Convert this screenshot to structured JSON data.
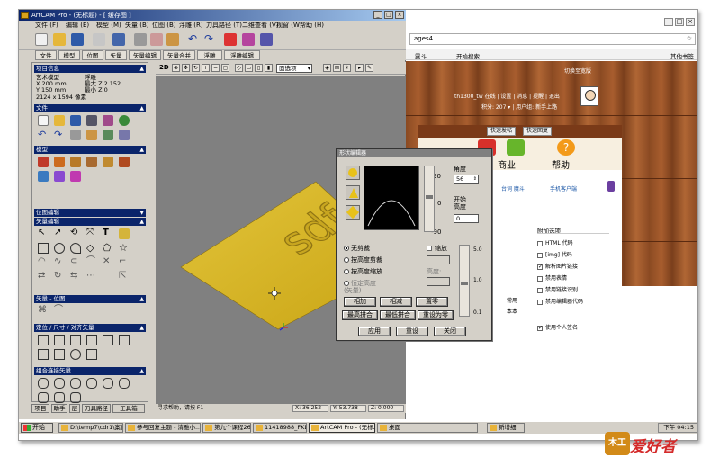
{
  "artcam": {
    "title": "ArtCAM Pro - (无标题) - [ 缓存图 ]",
    "menu": [
      "文件 (F)",
      "编辑 (E)",
      "模型 (M)",
      "矢量 (B)",
      "位图 (B)",
      "浮雕 (R)",
      "刀具路径 (T)",
      "二维查看 (V)",
      "视窗 (W)",
      "帮助 (H)"
    ],
    "tabs": [
      "文件",
      "模型",
      "位图",
      "矢量",
      "矢量编辑",
      "矢量合并",
      "浮雕",
      "浮雕编辑"
    ],
    "panel": {
      "project_header": "项目信息",
      "art_model_label": "艺术模型",
      "relief_label": "浮雕",
      "width": "X 200 mm",
      "height": "Y 150 mm",
      "zmax": "最大 Z 2.152",
      "zmin": "最小 Z 0",
      "pixels": "2124 x 1594 像素",
      "file_header": "文件",
      "model_header": "模型",
      "bitmap_edit_header": "位图编辑",
      "vector_edit_header": "矢量编辑",
      "vector_bitmap_header": "矢量 - 位图",
      "position_header": "定位 / 尺寸 / 对齐矢量",
      "combine_header": "组合连接矢量",
      "bottom_tabs": [
        "项目",
        "助手",
        "层",
        "刀具路径",
        "工具箱"
      ]
    },
    "view": {
      "dropdown_value": "面选项",
      "mode": "2D",
      "relief_text": "sdf",
      "status_hint": "寻求帮助，请按 F1",
      "coord_x": "X: 36.252",
      "coord_y": "Y: 53.738",
      "coord_z": "Z: 0.000"
    }
  },
  "dialog": {
    "title": "形状编辑器",
    "angle_label": "角度",
    "angle_value": "56",
    "top_value": "90",
    "zero_value": "0",
    "bottom_value": "-90",
    "start_height_label": "开始\n高度",
    "start_height_value": "0",
    "radio_unclip": "无剪裁",
    "radio_clip_height": "按高度剪裁",
    "radio_scale_height": "按高度缩放",
    "radio_fixed_height": "恒定高度\n(矢量)",
    "scale_label": "缩放",
    "height_label": "高度:",
    "slider_top": "5.0",
    "slider_mid": "1.0",
    "slider_bottom": "0.1",
    "btn_add": "相加",
    "btn_subtract": "相减",
    "btn_zero": "置零",
    "btn_merge_high": "最高拼合",
    "btn_merge_low": "最低拼合",
    "btn_reset_zero": "重设为零",
    "btn_apply": "应用",
    "btn_reset": "重设",
    "btn_close": "关闭"
  },
  "browser": {
    "address": "ages4",
    "bookmark_left": "露斗",
    "bookmark_mid": "开始搜索",
    "bookmark_right": "其他书签",
    "login_hint": "切换至宽版",
    "user_line": "th1300_tw 在线 | 设置 | 消息 | 提醒 | 退出",
    "points_line": "积分: 207 ▾ | 用户组: 新手上路",
    "quick_post": "快速发帖",
    "quick_reply": "快速回复",
    "nav_business": "商业",
    "nav_help": "帮助",
    "sub_links": "台词 魔斗",
    "mobile_client": "手机客户端",
    "attach_options": "附加选项",
    "options": [
      {
        "label": "HTML 代码",
        "checked": false
      },
      {
        "label": "[img] 代码",
        "checked": false
      },
      {
        "label": "解析图片链接",
        "checked": true
      },
      {
        "label": "禁用表情",
        "checked": false
      },
      {
        "label": "禁用链接识别",
        "checked": false
      },
      {
        "label": "禁用编辑器代码",
        "checked": false
      },
      {
        "label": "使用个人签名",
        "checked": true
      }
    ],
    "side_tab_common": "常用",
    "side_tab_text": "本本"
  },
  "taskbar": {
    "start": "开始",
    "tasks": [
      "D:\\temp7\\cdr1\\案代码\\",
      "参与回复主题 - 清雅小...",
      "第九个课程26.mov",
      "11418988_FKDD Malls",
      "ArtCAM Pro - (无标...",
      "桌面",
      "新增细"
    ],
    "clock": "下午 04:15"
  },
  "watermark": {
    "text": "爱好者",
    "prefix": "木工"
  },
  "colors": {
    "titlebar": "#0a246a",
    "relief": "#d8b41e",
    "viewport": "#808080",
    "wood": "#a85d2e"
  }
}
